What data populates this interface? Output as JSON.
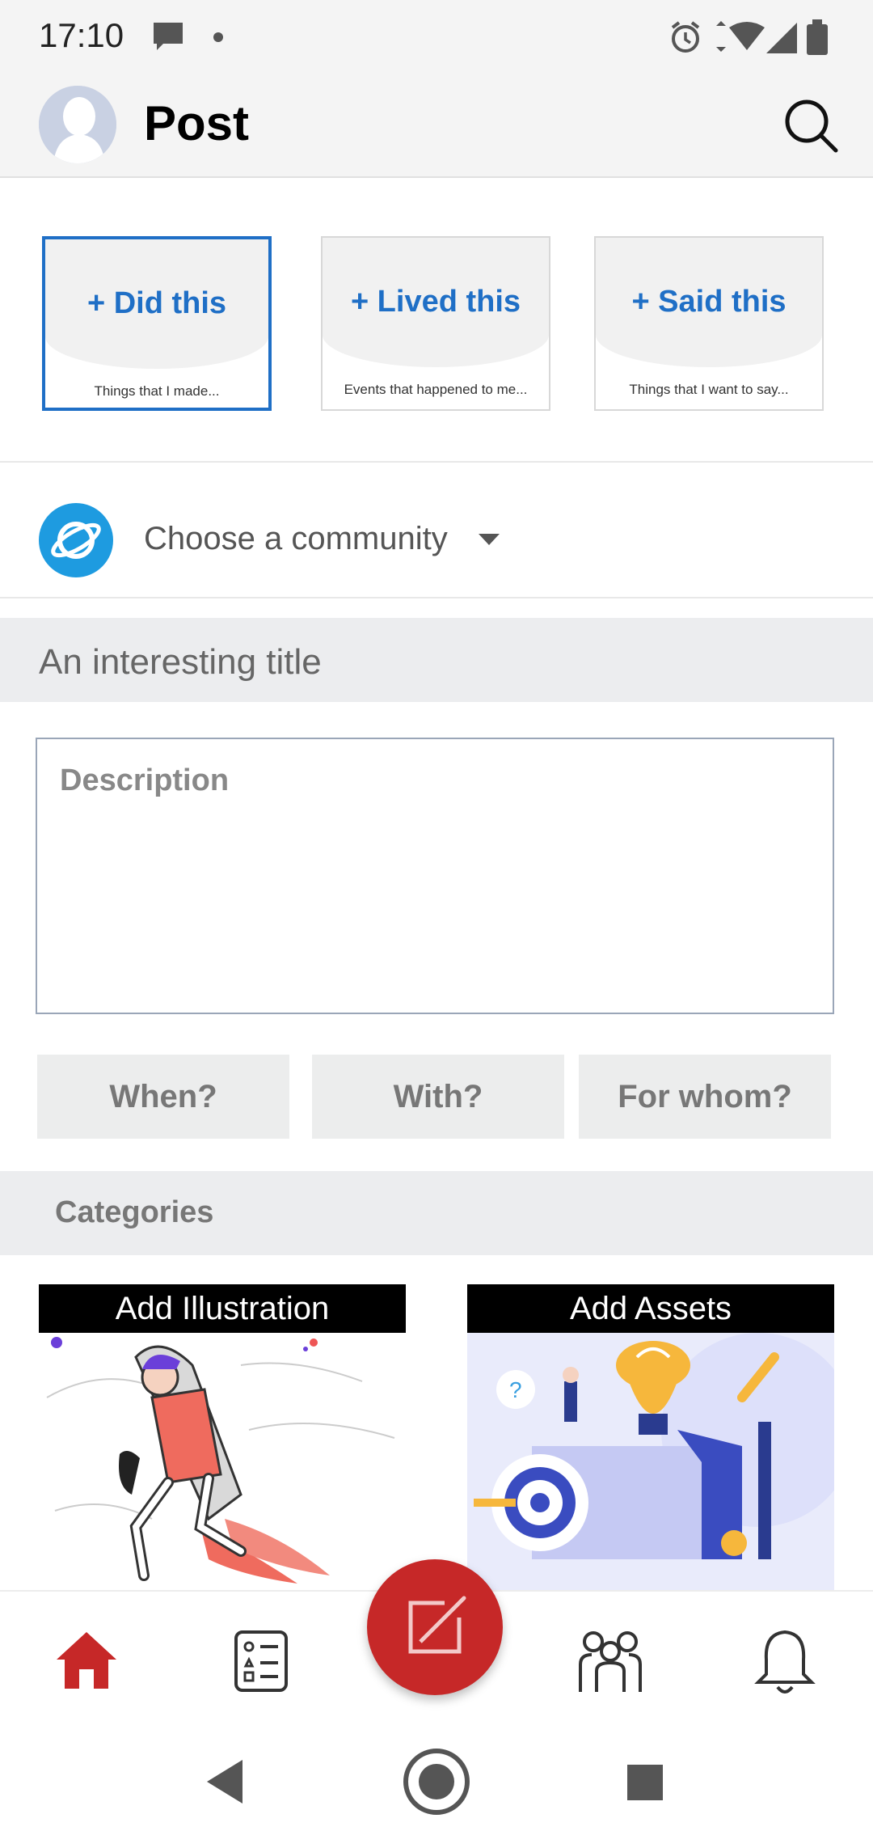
{
  "status_bar": {
    "time": "17:10",
    "icons": [
      "message-icon",
      "dot-icon",
      "alarm-icon",
      "wifi-icon",
      "signal-icon",
      "battery-icon"
    ]
  },
  "header": {
    "title": "Post",
    "avatar": "avatar-placeholder",
    "search_icon": "search-icon"
  },
  "post_types": [
    {
      "label": "+ Did this",
      "sub": "Things that I made...",
      "selected": true
    },
    {
      "label": "+ Lived this",
      "sub": "Events that happened to me...",
      "selected": false
    },
    {
      "label": "+ Said this",
      "sub": "Things that I want to say...",
      "selected": false
    }
  ],
  "community": {
    "label": "Choose a community",
    "icon": "planet-icon"
  },
  "title_field": {
    "placeholder": "An interesting title"
  },
  "description_field": {
    "placeholder": "Description"
  },
  "chips": [
    "When?",
    "With?",
    "For whom?"
  ],
  "categories": {
    "label": "Categories"
  },
  "media": {
    "illustration_label": "Add Illustration",
    "assets_label": "Add Assets"
  },
  "bottom_nav": {
    "items": [
      "home-icon",
      "list-icon",
      "compose-icon",
      "people-icon",
      "bell-icon"
    ],
    "active": "home-icon"
  },
  "colors": {
    "accent": "#1f6fc6",
    "brand_red": "#c62828",
    "community_blue": "#1e9be0"
  }
}
